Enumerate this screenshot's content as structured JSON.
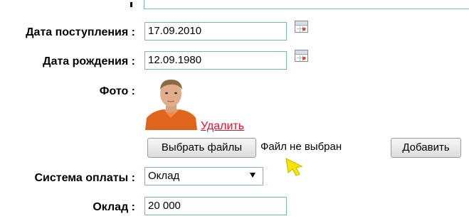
{
  "form": {
    "arrival_date_label": "Дата поступления :",
    "arrival_date_value": "17.09.2010",
    "birth_date_label": "Дата рождения :",
    "birth_date_value": "12.09.1980",
    "photo_label": "Фото :",
    "delete_link": "Удалить",
    "choose_files_button": "Выбрать файлы",
    "file_status": "Файл не выбран",
    "add_button": "Добавить",
    "payment_system_label": "Система оплаты :",
    "payment_system_value": "Оклад",
    "salary_label": "Оклад :",
    "salary_value": "20 000"
  },
  "icons": {
    "calendar": "calendar-icon",
    "dropdown": "dropdown-arrow-icon",
    "cursor": "mouse-cursor-icon"
  },
  "colors": {
    "input_border": "#7fb5b7",
    "link": "#e8112d",
    "cursor": "#f5e400"
  }
}
